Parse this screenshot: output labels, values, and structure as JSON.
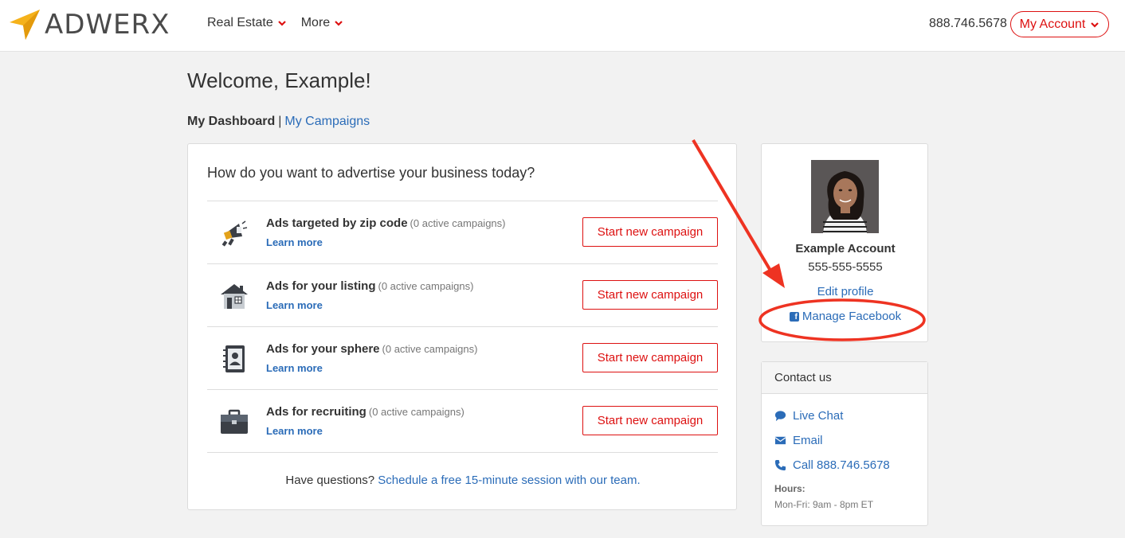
{
  "brand": {
    "name": "ADWERX",
    "accent": "#dd1111",
    "link": "#2b6cb8",
    "logo_color": "#f5b21b"
  },
  "nav": {
    "items": [
      {
        "label": "Real Estate"
      },
      {
        "label": "More"
      }
    ]
  },
  "header": {
    "phone": "888.746.5678",
    "account_label": "My Account"
  },
  "page": {
    "welcome": "Welcome, Example!"
  },
  "breadcrumb": {
    "current": "My Dashboard",
    "separator": "|",
    "link": "My Campaigns"
  },
  "main": {
    "question": "How do you want to advertise your business today?",
    "rows": [
      {
        "title": "Ads targeted by zip code",
        "count": "(0 active campaigns)",
        "learn": "Learn more",
        "button": "Start new campaign",
        "icon": "megaphone-icon"
      },
      {
        "title": "Ads for your listing",
        "count": "(0 active campaigns)",
        "learn": "Learn more",
        "button": "Start new campaign",
        "icon": "house-icon"
      },
      {
        "title": "Ads for your sphere",
        "count": "(0 active campaigns)",
        "learn": "Learn more",
        "button": "Start new campaign",
        "icon": "contact-book-icon"
      },
      {
        "title": "Ads for recruiting",
        "count": "(0 active campaigns)",
        "learn": "Learn more",
        "button": "Start new campaign",
        "icon": "briefcase-icon"
      }
    ],
    "questions_prefix": "Have questions?",
    "questions_link": "Schedule a free 15-minute session with our team."
  },
  "profile": {
    "name": "Example Account",
    "phone": "555-555-5555",
    "edit_label": "Edit profile",
    "facebook_label": "Manage Facebook"
  },
  "contact": {
    "heading": "Contact us",
    "items": [
      {
        "label": "Live Chat",
        "icon": "chat-icon"
      },
      {
        "label": "Email",
        "icon": "envelope-icon"
      },
      {
        "label": "Call 888.746.5678",
        "icon": "phone-icon"
      }
    ],
    "hours_label": "Hours:",
    "hours_value": "Mon-Fri: 9am - 8pm ET"
  },
  "annotation": {
    "color": "#ee3322"
  }
}
